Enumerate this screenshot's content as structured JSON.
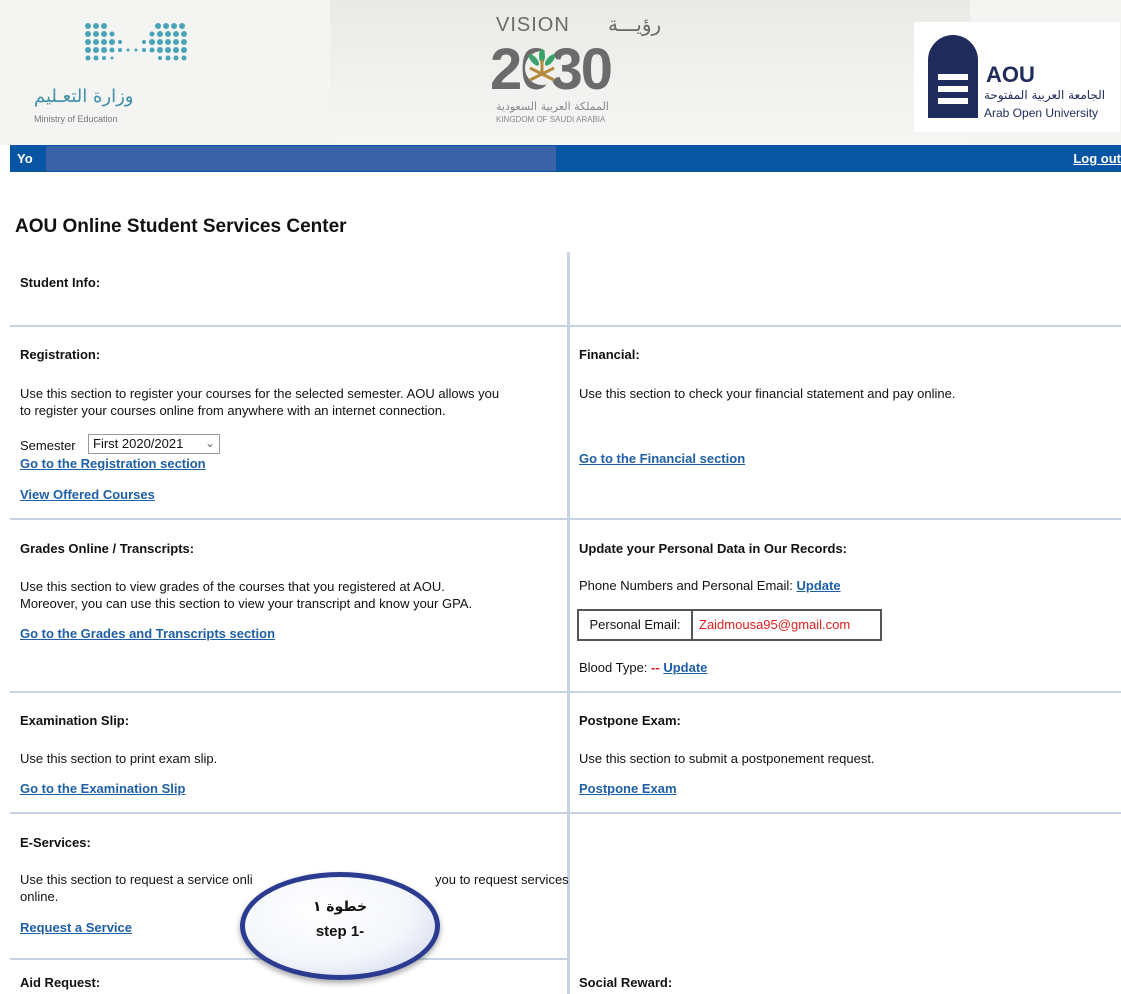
{
  "header": {
    "moe_ar": "وزارة التعـليم",
    "moe_en": "Ministry of Education",
    "vision_en": "VISION",
    "vision_ar": "رؤيـــة",
    "vision_year": "2030",
    "kingdom_ar": "المملكة العربية السعودية",
    "kingdom_en": "KINGDOM OF SAUDI ARABIA",
    "aou_abbr": "AOU",
    "aou_ar": "الجامعة العربية المفتوحة",
    "aou_en": "Arab Open University",
    "brand_color": "#1f2c5c"
  },
  "topbar": {
    "you_label": "Yo",
    "logout_label": "Log out",
    "bar_color": "#0755a3"
  },
  "page_title": "AOU Online Student Services Center",
  "student_info": {
    "label": "Student Info:"
  },
  "registration": {
    "label": "Registration:",
    "desc_line1": "Use this section to register your courses for the selected semester. AOU allows you",
    "desc_line2": "to register your courses online from anywhere with an internet connection.",
    "semester_label": "Semester",
    "semester_value": "First 2020/2021",
    "go_link": "Go to the Registration section",
    "offered_link": "View Offered Courses"
  },
  "financial": {
    "label": "Financial:",
    "desc": "Use this section to check your financial statement and pay online.",
    "go_link": "Go to the Financial section"
  },
  "grades": {
    "label": "Grades Online / Transcripts:",
    "desc_line1": "Use this section to view grades of the courses that you registered at AOU.",
    "desc_line2": "Moreover, you can use this section to view your transcript and know your GPA.",
    "go_link": "Go to the Grades and Transcripts section"
  },
  "personal": {
    "label": "Update your Personal Data in Our Records:",
    "phone_text": "Phone Numbers and Personal Email:",
    "update_link": "Update",
    "email_label": "Personal Email:",
    "email_value": "Zaidmousa95@gmail.com",
    "blood_label": "Blood Type:",
    "blood_value": "--",
    "blood_update_link": "Update"
  },
  "exam_slip": {
    "label": "Examination Slip:",
    "desc": "Use this section to print exam slip.",
    "go_link": "Go to the Examination Slip"
  },
  "postpone": {
    "label": "Postpone Exam:",
    "desc": "Use this section to submit a postponement request.",
    "go_link": "Postpone Exam"
  },
  "eservices": {
    "label": "E-Services:",
    "desc_part1": "Use this section to request a service onli",
    "desc_part2": "you to request services",
    "desc_line2": "online.",
    "go_link": "Request a Service"
  },
  "aid": {
    "label": "Aid Request:"
  },
  "social": {
    "label": "Social Reward:"
  },
  "callout": {
    "ar": "خطوة ١",
    "en": "step 1-"
  }
}
